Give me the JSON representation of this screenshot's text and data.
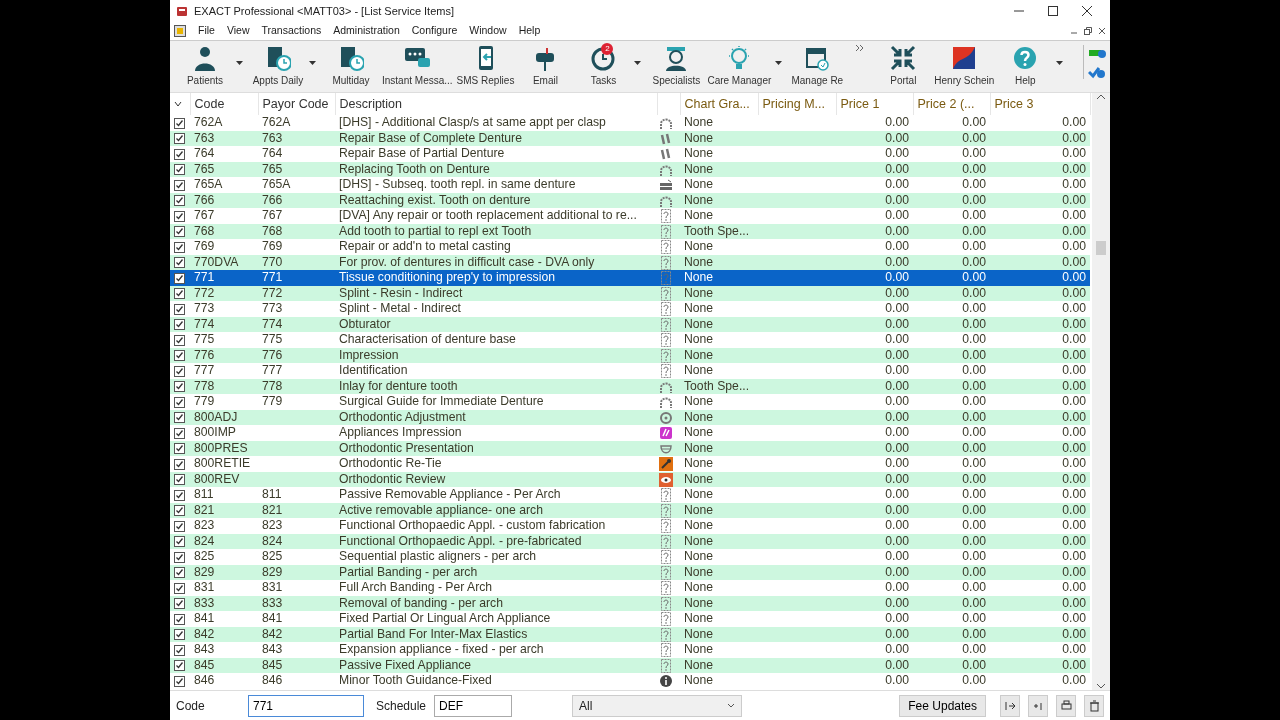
{
  "window": {
    "title": "EXACT Professional <MATT03> - [List Service Items]"
  },
  "menu": [
    "File",
    "View",
    "Transactions",
    "Administration",
    "Configure",
    "Window",
    "Help"
  ],
  "toolbar": [
    {
      "label": "Patients",
      "kind": "person",
      "dropdown": true
    },
    {
      "label": "Appts Daily",
      "kind": "book-clock",
      "dropdown": true
    },
    {
      "label": "Multiday",
      "kind": "book-clock",
      "dropdown": false
    },
    {
      "label": "Instant Messa...",
      "kind": "chat",
      "dropdown": false
    },
    {
      "label": "SMS Replies",
      "kind": "phone",
      "dropdown": false
    },
    {
      "label": "Email",
      "kind": "mailbox",
      "dropdown": false
    },
    {
      "label": "Tasks",
      "kind": "alarm",
      "dropdown": true,
      "badge": "2"
    },
    {
      "label": "Specialists",
      "kind": "doctor",
      "dropdown": false
    },
    {
      "label": "Care Manager",
      "kind": "bulb",
      "dropdown": true
    },
    {
      "label": "Manage Re",
      "kind": "calendar",
      "dropdown": false
    },
    {
      "label": "Portal",
      "kind": "arrows",
      "dropdown": false
    },
    {
      "label": "Henry Schein",
      "kind": "flag",
      "dropdown": false
    },
    {
      "label": "Help",
      "kind": "help",
      "dropdown": true
    }
  ],
  "table": {
    "columns": [
      "Code",
      "Payor Code",
      "Description",
      "Chart Gra...",
      "Pricing M...",
      "Price 1",
      "Price 2 (...",
      "Price 3"
    ],
    "rows": [
      {
        "checked": true,
        "code": "762A",
        "payor_code": "762A",
        "description": "[DHS] - Additional Clasp/s at same appt per clasp",
        "kind": "arch",
        "chart_grade": "None",
        "price_1": "0.00",
        "price_2": "0.00",
        "price_3": "0.00",
        "selected": false
      },
      {
        "checked": true,
        "code": "763",
        "payor_code": "763",
        "description": "Repair Base of Complete Denture",
        "kind": "partial",
        "chart_grade": "None",
        "price_1": "0.00",
        "price_2": "0.00",
        "price_3": "0.00",
        "selected": false
      },
      {
        "checked": true,
        "code": "764",
        "payor_code": "764",
        "description": "Repair Base of Partial Denture",
        "kind": "partial",
        "chart_grade": "None",
        "price_1": "0.00",
        "price_2": "0.00",
        "price_3": "0.00",
        "selected": false
      },
      {
        "checked": true,
        "code": "765",
        "payor_code": "765",
        "description": "Replacing Tooth on Denture",
        "kind": "arch",
        "chart_grade": "None",
        "price_1": "0.00",
        "price_2": "0.00",
        "price_3": "0.00",
        "selected": false
      },
      {
        "checked": true,
        "code": "765A",
        "payor_code": "765A",
        "description": "[DHS] - Subseq. tooth repl. in same denture",
        "kind": "bricks",
        "chart_grade": "None",
        "price_1": "0.00",
        "price_2": "0.00",
        "price_3": "0.00",
        "selected": false
      },
      {
        "checked": true,
        "code": "766",
        "payor_code": "766",
        "description": "Reattaching exist. Tooth on denture",
        "kind": "arch",
        "chart_grade": "None",
        "price_1": "0.00",
        "price_2": "0.00",
        "price_3": "0.00",
        "selected": false
      },
      {
        "checked": true,
        "code": "767",
        "payor_code": "767",
        "description": "[DVA] Any repair or tooth replacement additional to re...",
        "kind": "unknown",
        "chart_grade": "None",
        "price_1": "0.00",
        "price_2": "0.00",
        "price_3": "0.00",
        "selected": false
      },
      {
        "checked": true,
        "code": "768",
        "payor_code": "768",
        "description": "Add tooth to partial to repl ext Tooth",
        "kind": "unknown",
        "chart_grade": "Tooth Spe...",
        "price_1": "0.00",
        "price_2": "0.00",
        "price_3": "0.00",
        "selected": false
      },
      {
        "checked": true,
        "code": "769",
        "payor_code": "769",
        "description": "Repair or add'n to metal casting",
        "kind": "unknown",
        "chart_grade": "None",
        "price_1": "0.00",
        "price_2": "0.00",
        "price_3": "0.00",
        "selected": false
      },
      {
        "checked": true,
        "code": "770DVA",
        "payor_code": "770",
        "description": "For prov. of dentures in difficult case - DVA only",
        "kind": "unknown",
        "chart_grade": "None",
        "price_1": "0.00",
        "price_2": "0.00",
        "price_3": "0.00",
        "selected": false
      },
      {
        "checked": true,
        "code": "771",
        "payor_code": "771",
        "description": "Tissue conditioning prep'y to impression",
        "kind": "unknown",
        "chart_grade": "None",
        "price_1": "0.00",
        "price_2": "0.00",
        "price_3": "0.00",
        "selected": true
      },
      {
        "checked": true,
        "code": "772",
        "payor_code": "772",
        "description": "Splint - Resin - Indirect",
        "kind": "unknown",
        "chart_grade": "None",
        "price_1": "0.00",
        "price_2": "0.00",
        "price_3": "0.00",
        "selected": false
      },
      {
        "checked": true,
        "code": "773",
        "payor_code": "773",
        "description": "Splint - Metal - Indirect",
        "kind": "unknown",
        "chart_grade": "None",
        "price_1": "0.00",
        "price_2": "0.00",
        "price_3": "0.00",
        "selected": false
      },
      {
        "checked": true,
        "code": "774",
        "payor_code": "774",
        "description": "Obturator",
        "kind": "unknown",
        "chart_grade": "None",
        "price_1": "0.00",
        "price_2": "0.00",
        "price_3": "0.00",
        "selected": false
      },
      {
        "checked": true,
        "code": "775",
        "payor_code": "775",
        "description": "Characterisation of denture base",
        "kind": "unknown",
        "chart_grade": "None",
        "price_1": "0.00",
        "price_2": "0.00",
        "price_3": "0.00",
        "selected": false
      },
      {
        "checked": true,
        "code": "776",
        "payor_code": "776",
        "description": "Impression",
        "kind": "unknown",
        "chart_grade": "None",
        "price_1": "0.00",
        "price_2": "0.00",
        "price_3": "0.00",
        "selected": false
      },
      {
        "checked": true,
        "code": "777",
        "payor_code": "777",
        "description": "Identification",
        "kind": "unknown",
        "chart_grade": "None",
        "price_1": "0.00",
        "price_2": "0.00",
        "price_3": "0.00",
        "selected": false
      },
      {
        "checked": true,
        "code": "778",
        "payor_code": "778",
        "description": "Inlay for denture tooth",
        "kind": "arch",
        "chart_grade": "Tooth Spe...",
        "price_1": "0.00",
        "price_2": "0.00",
        "price_3": "0.00",
        "selected": false
      },
      {
        "checked": true,
        "code": "779",
        "payor_code": "779",
        "description": "Surgical Guide for Immediate Denture",
        "kind": "arch",
        "chart_grade": "None",
        "price_1": "0.00",
        "price_2": "0.00",
        "price_3": "0.00",
        "selected": false
      },
      {
        "checked": true,
        "code": "800ADJ",
        "description": "Orthodontic Adjustment",
        "kind": "brace",
        "chart_grade": "None",
        "price_1": "0.00",
        "price_2": "0.00",
        "price_3": "0.00",
        "selected": false
      },
      {
        "checked": true,
        "code": "800IMP",
        "description": "Appliances Impression",
        "kind": "pink",
        "chart_grade": "None",
        "price_1": "0.00",
        "price_2": "0.00",
        "price_3": "0.00",
        "selected": false
      },
      {
        "checked": true,
        "code": "800PRES",
        "description": "Orthodontic Presentation",
        "kind": "smile",
        "chart_grade": "None",
        "price_1": "0.00",
        "price_2": "0.00",
        "price_3": "0.00",
        "selected": false
      },
      {
        "checked": true,
        "code": "800RETIE",
        "description": "Orthodontic Re-Tie",
        "kind": "wrench",
        "chart_grade": "None",
        "price_1": "0.00",
        "price_2": "0.00",
        "price_3": "0.00",
        "selected": false
      },
      {
        "checked": true,
        "code": "800REV",
        "description": "Orthodontic Review",
        "kind": "eye",
        "chart_grade": "None",
        "price_1": "0.00",
        "price_2": "0.00",
        "price_3": "0.00",
        "selected": false
      },
      {
        "checked": true,
        "code": "811",
        "payor_code": "811",
        "description": "Passive Removable Appliance - Per Arch",
        "kind": "unknown",
        "chart_grade": "None",
        "price_1": "0.00",
        "price_2": "0.00",
        "price_3": "0.00",
        "selected": false
      },
      {
        "checked": true,
        "code": "821",
        "payor_code": "821",
        "description": "Active removable appliance- one arch",
        "kind": "unknown",
        "chart_grade": "None",
        "price_1": "0.00",
        "price_2": "0.00",
        "price_3": "0.00",
        "selected": false
      },
      {
        "checked": true,
        "code": "823",
        "payor_code": "823",
        "description": "Functional Orthopaedic Appl. - custom fabrication",
        "kind": "unknown",
        "chart_grade": "None",
        "price_1": "0.00",
        "price_2": "0.00",
        "price_3": "0.00",
        "selected": false
      },
      {
        "checked": true,
        "code": "824",
        "payor_code": "824",
        "description": "Functional Orthopaedic Appl. - pre-fabricated",
        "kind": "unknown",
        "chart_grade": "None",
        "price_1": "0.00",
        "price_2": "0.00",
        "price_3": "0.00",
        "selected": false
      },
      {
        "checked": true,
        "code": "825",
        "payor_code": "825",
        "description": "Sequential plastic aligners - per arch",
        "kind": "unknown",
        "chart_grade": "None",
        "price_1": "0.00",
        "price_2": "0.00",
        "price_3": "0.00",
        "selected": false
      },
      {
        "checked": true,
        "code": "829",
        "payor_code": "829",
        "description": "Partial Banding - per arch",
        "kind": "unknown",
        "chart_grade": "None",
        "price_1": "0.00",
        "price_2": "0.00",
        "price_3": "0.00",
        "selected": false
      },
      {
        "checked": true,
        "code": "831",
        "payor_code": "831",
        "description": "Full Arch Banding - Per Arch",
        "kind": "unknown",
        "chart_grade": "None",
        "price_1": "0.00",
        "price_2": "0.00",
        "price_3": "0.00",
        "selected": false
      },
      {
        "checked": true,
        "code": "833",
        "payor_code": "833",
        "description": "Removal of banding - per arch",
        "kind": "unknown",
        "chart_grade": "None",
        "price_1": "0.00",
        "price_2": "0.00",
        "price_3": "0.00",
        "selected": false
      },
      {
        "checked": true,
        "code": "841",
        "payor_code": "841",
        "description": "Fixed Partial Or Lingual Arch Appliance",
        "kind": "unknown",
        "chart_grade": "None",
        "price_1": "0.00",
        "price_2": "0.00",
        "price_3": "0.00",
        "selected": false
      },
      {
        "checked": true,
        "code": "842",
        "payor_code": "842",
        "description": "Partial Band For Inter-Max Elastics",
        "kind": "unknown",
        "chart_grade": "None",
        "price_1": "0.00",
        "price_2": "0.00",
        "price_3": "0.00",
        "selected": false
      },
      {
        "checked": true,
        "code": "843",
        "payor_code": "843",
        "description": "Expansion appliance - fixed - per arch",
        "kind": "unknown",
        "chart_grade": "None",
        "price_1": "0.00",
        "price_2": "0.00",
        "price_3": "0.00",
        "selected": false
      },
      {
        "checked": true,
        "code": "845",
        "payor_code": "845",
        "description": "Passive Fixed Appliance",
        "kind": "unknown",
        "chart_grade": "None",
        "price_1": "0.00",
        "price_2": "0.00",
        "price_3": "0.00",
        "selected": false
      },
      {
        "checked": true,
        "code": "846",
        "payor_code": "846",
        "description": "Minor Tooth Guidance-Fixed",
        "kind": "info",
        "chart_grade": "None",
        "price_1": "0.00",
        "price_2": "0.00",
        "price_3": "0.00",
        "selected": false
      }
    ]
  },
  "filter_bar": {
    "code_label": "Code",
    "code_value": "771",
    "schedule_label": "Schedule",
    "schedule_value": "DEF",
    "dropdown_value": "All",
    "fee_updates_button": "Fee Updates"
  }
}
